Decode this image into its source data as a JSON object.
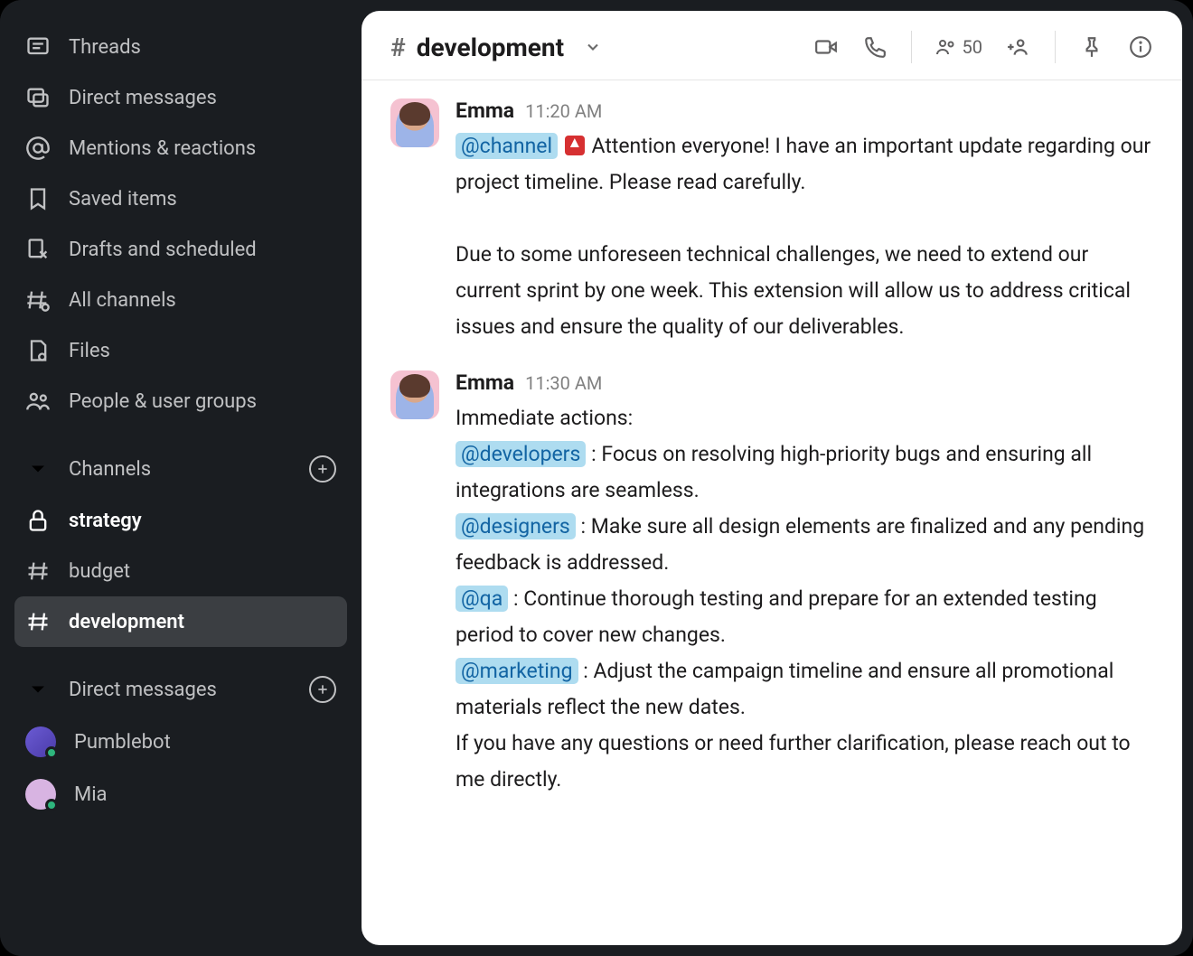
{
  "sidebar": {
    "nav": [
      {
        "id": "threads",
        "label": "Threads"
      },
      {
        "id": "dms",
        "label": "Direct messages"
      },
      {
        "id": "mentions",
        "label": "Mentions & reactions"
      },
      {
        "id": "saved",
        "label": "Saved items"
      },
      {
        "id": "drafts",
        "label": "Drafts and scheduled"
      },
      {
        "id": "all-channels",
        "label": "All channels"
      },
      {
        "id": "files",
        "label": "Files"
      },
      {
        "id": "people",
        "label": "People & user groups"
      }
    ],
    "channels_header": "Channels",
    "channels": [
      {
        "name": "strategy",
        "locked": true,
        "active": false
      },
      {
        "name": "budget",
        "locked": false,
        "active": false
      },
      {
        "name": "development",
        "locked": false,
        "active": true
      }
    ],
    "dms_header": "Direct messages",
    "dms": [
      {
        "name": "Pumblebot",
        "kind": "bot"
      },
      {
        "name": "Mia",
        "kind": "mia"
      }
    ]
  },
  "channel": {
    "name": "development",
    "member_count": "50"
  },
  "messages": [
    {
      "author": "Emma",
      "time": "11:20 AM",
      "avatar": "emma",
      "paragraphs": [
        [
          {
            "type": "mention",
            "text": "@channel"
          },
          {
            "type": "text",
            "text": " "
          },
          {
            "type": "siren"
          },
          {
            "type": "text",
            "text": " Attention everyone! I have an important update regarding our project timeline. Please read carefully."
          }
        ],
        [],
        [
          {
            "type": "text",
            "text": "Due to some unforeseen technical challenges, we need to extend our current sprint by one week. This extension will allow us to address critical issues and ensure the quality of our deliverables."
          }
        ]
      ]
    },
    {
      "author": "Emma",
      "time": "11:30 AM",
      "avatar": "emma",
      "paragraphs": [
        [
          {
            "type": "text",
            "text": "Immediate actions:"
          }
        ],
        [
          {
            "type": "mention",
            "text": "@developers"
          },
          {
            "type": "text",
            "text": " : Focus on resolving high-priority bugs and ensuring all integrations are seamless."
          }
        ],
        [
          {
            "type": "mention",
            "text": "@designers"
          },
          {
            "type": "text",
            "text": " : Make sure all design elements are finalized and any pending feedback is addressed."
          }
        ],
        [
          {
            "type": "mention",
            "text": "@qa"
          },
          {
            "type": "text",
            "text": " : Continue thorough testing and prepare for an extended testing period to cover new changes."
          }
        ],
        [
          {
            "type": "mention",
            "text": "@marketing"
          },
          {
            "type": "text",
            "text": " : Adjust the campaign timeline and ensure all promotional materials reflect the new dates."
          }
        ],
        [
          {
            "type": "text",
            "text": "If you have any questions or need further clarification, please reach out to me directly."
          }
        ]
      ]
    }
  ]
}
